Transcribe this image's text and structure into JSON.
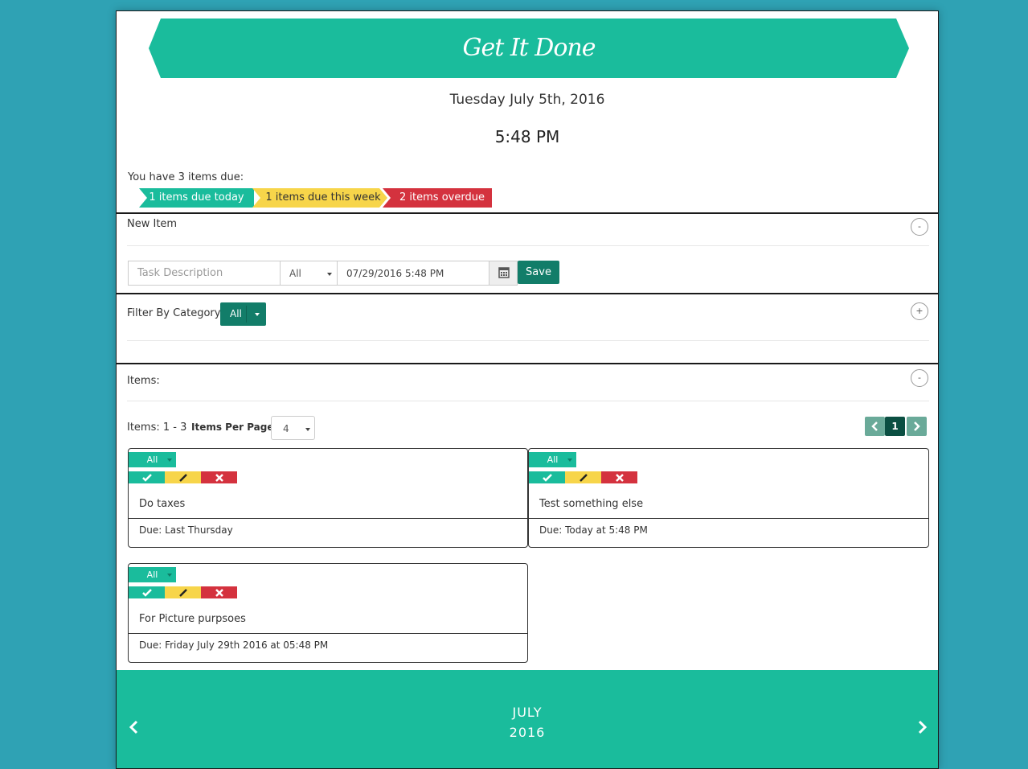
{
  "app": {
    "title": "Get It Done",
    "date": "Tuesday July 5th, 2016",
    "time": "5:48 PM"
  },
  "summary": {
    "text": "You have 3 items due:",
    "badges": [
      {
        "label": "1 items due today",
        "color": "#1abc9c",
        "text_color": "#ffffff"
      },
      {
        "label": "1 items due this week",
        "color": "#f7d54a",
        "text_color": "#333333"
      },
      {
        "label": "2 items overdue",
        "color": "#d4323e",
        "text_color": "#ffffff"
      }
    ]
  },
  "new_item": {
    "title": "New Item",
    "toggle": "-",
    "task_placeholder": "Task Description",
    "category_value": "All",
    "date_value": "07/29/2016 5:48 PM",
    "calendar_icon": "calendar-icon",
    "save_label": "Save"
  },
  "filter": {
    "label": "Filter By Category:",
    "value": "All",
    "toggle": "+"
  },
  "items": {
    "title": "Items:",
    "toggle": "-",
    "range": "Items: 1 - 3",
    "per_page_label": "Items Per Page:",
    "per_page_value": "4",
    "pager": {
      "prev_icon": "chevron-left-icon",
      "current": "1",
      "next_icon": "chevron-right-icon"
    },
    "cards": [
      {
        "category": "All",
        "task": "Do taxes",
        "due": "Due: Last Thursday"
      },
      {
        "category": "All",
        "task": "Test something else",
        "due": "Due: Today at 5:48 PM"
      },
      {
        "category": "All",
        "task": "For Picture purpsoes",
        "due": "Due: Friday July 29th 2016 at 05:48 PM"
      }
    ],
    "actions": [
      {
        "icon": "check-icon",
        "color": "#1abc9c"
      },
      {
        "icon": "pencil-icon",
        "color": "#f7d54a"
      },
      {
        "icon": "times-icon",
        "color": "#d4323e"
      }
    ]
  },
  "calendar": {
    "month": "JULY",
    "year": "2016",
    "prev_icon": "chevron-left-icon",
    "next_icon": "chevron-right-icon"
  },
  "colors": {
    "background": "#2fa2b4",
    "accent": "#1abc9c",
    "button_dark": "#127d69",
    "warning": "#f7d54a",
    "danger": "#d4323e"
  }
}
